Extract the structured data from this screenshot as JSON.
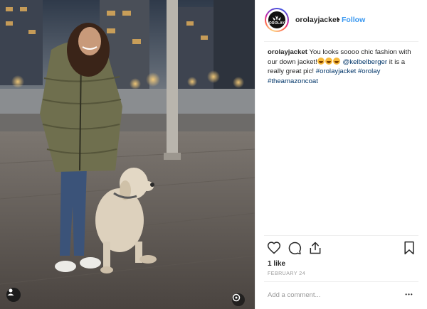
{
  "post": {
    "username": "orolayjacket",
    "separator": "•",
    "follow_label": "Follow",
    "avatar_brand": "OROLAY"
  },
  "caption": {
    "username": "orolayjacket",
    "text_part1": "You looks soooo chic fashion with our down jacket!",
    "emojis": [
      "heart-eyes",
      "heart-eyes",
      "heart-eyes"
    ],
    "mention": "@kelbelberger",
    "text_part2": "it is a really great pic!",
    "hashtags": [
      "#orolayjacket",
      "#orolay",
      "#theamazoncoat"
    ]
  },
  "actions": {
    "icons": [
      "heart-icon",
      "comment-icon",
      "share-icon",
      "bookmark-icon"
    ]
  },
  "likes_label": "1 like",
  "date_label": "FEBRUARY 24",
  "comment": {
    "placeholder": "Add a comment...",
    "value": ""
  },
  "more_label": "•••",
  "colors": {
    "follow": "#3897f0",
    "link": "#003569",
    "muted": "#999999",
    "text": "#262626"
  }
}
